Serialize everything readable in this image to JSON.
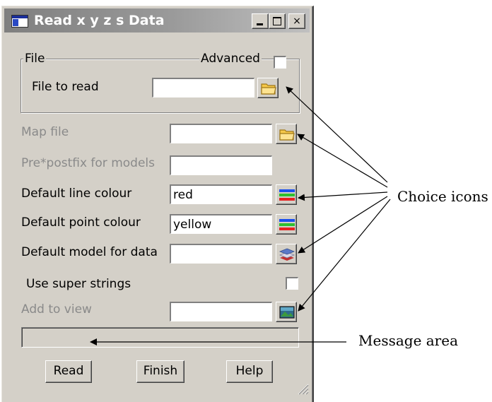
{
  "window": {
    "title": "Read x y z s Data",
    "min_glyph": "_",
    "max_glyph": "□",
    "close_glyph": "×"
  },
  "file_group": {
    "legend": "File",
    "advanced_label": "Advanced",
    "advanced_checked": false,
    "file_to_read_label": "File to read",
    "file_to_read_value": ""
  },
  "fields": {
    "map_file_label": "Map file",
    "map_file_value": "",
    "prepostfix_label": "Pre*postfix for models",
    "prepostfix_value": "",
    "line_colour_label": "Default line colour",
    "line_colour_value": "red",
    "point_colour_label": "Default point colour",
    "point_colour_value": "yellow",
    "model_label": "Default model for data",
    "model_value": "",
    "super_strings_label": "Use super strings",
    "super_strings_checked": false,
    "add_to_view_label": "Add to view",
    "add_to_view_value": ""
  },
  "message_area": "",
  "buttons": {
    "read": "Read",
    "finish": "Finish",
    "help": "Help"
  },
  "annotations": {
    "choice_icons": "Choice icons",
    "message_area": "Message area"
  },
  "icons": {
    "folder": "folder-icon",
    "colour": "colour-choice-icon",
    "model": "model-choice-icon",
    "view": "view-choice-icon"
  },
  "colors": {
    "dialog_bg": "#d4d0c8",
    "title_gradient_start": "#7f7f7f",
    "disabled_text": "#8a8a8a",
    "folder_yellow": "#f5c84a"
  }
}
